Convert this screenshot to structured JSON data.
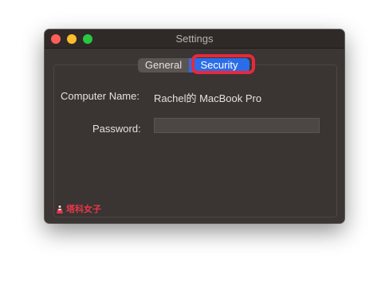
{
  "window": {
    "title": "Settings"
  },
  "tabs": [
    {
      "label": "General",
      "selected": false
    },
    {
      "label": "Security",
      "selected": true
    }
  ],
  "form": {
    "computer_name_label": "Computer Name:",
    "computer_name_value": "Rachel的 MacBook Pro",
    "password_label": "Password:",
    "password_value": ""
  },
  "watermark": {
    "text": "塔科女子",
    "icon": "woman-logo-icon"
  },
  "colors": {
    "window_background": "#3b3533",
    "selected_tab": "#2a6de8",
    "highlight_border": "#e8283d",
    "watermark_text": "#e8364a"
  }
}
